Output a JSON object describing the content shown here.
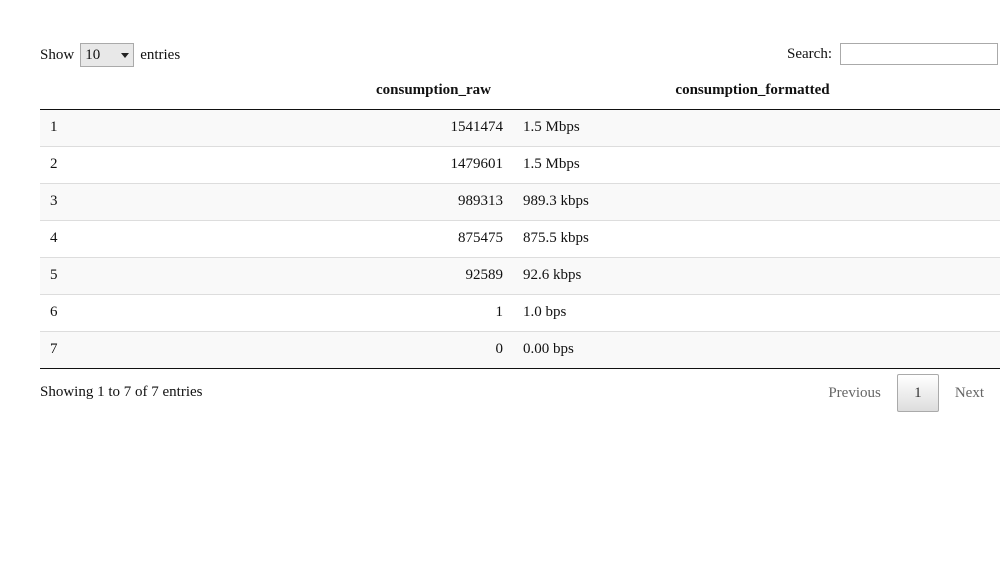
{
  "length": {
    "label_before": "Show",
    "value": "10",
    "label_after": "entries"
  },
  "search": {
    "label": "Search:",
    "value": ""
  },
  "table": {
    "headers": [
      "",
      "consumption_raw",
      "consumption_formatted"
    ],
    "rows": [
      [
        "1",
        "1541474",
        "1.5 Mbps"
      ],
      [
        "2",
        "1479601",
        "1.5 Mbps"
      ],
      [
        "3",
        "989313",
        "989.3 kbps"
      ],
      [
        "4",
        "875475",
        "875.5 kbps"
      ],
      [
        "5",
        "92589",
        "92.6 kbps"
      ],
      [
        "6",
        "1",
        "1.0 bps"
      ],
      [
        "7",
        "0",
        "0.00 bps"
      ]
    ]
  },
  "info": "Showing 1 to 7 of 7 entries",
  "pagination": {
    "previous": "Previous",
    "current": "1",
    "next": "Next"
  }
}
